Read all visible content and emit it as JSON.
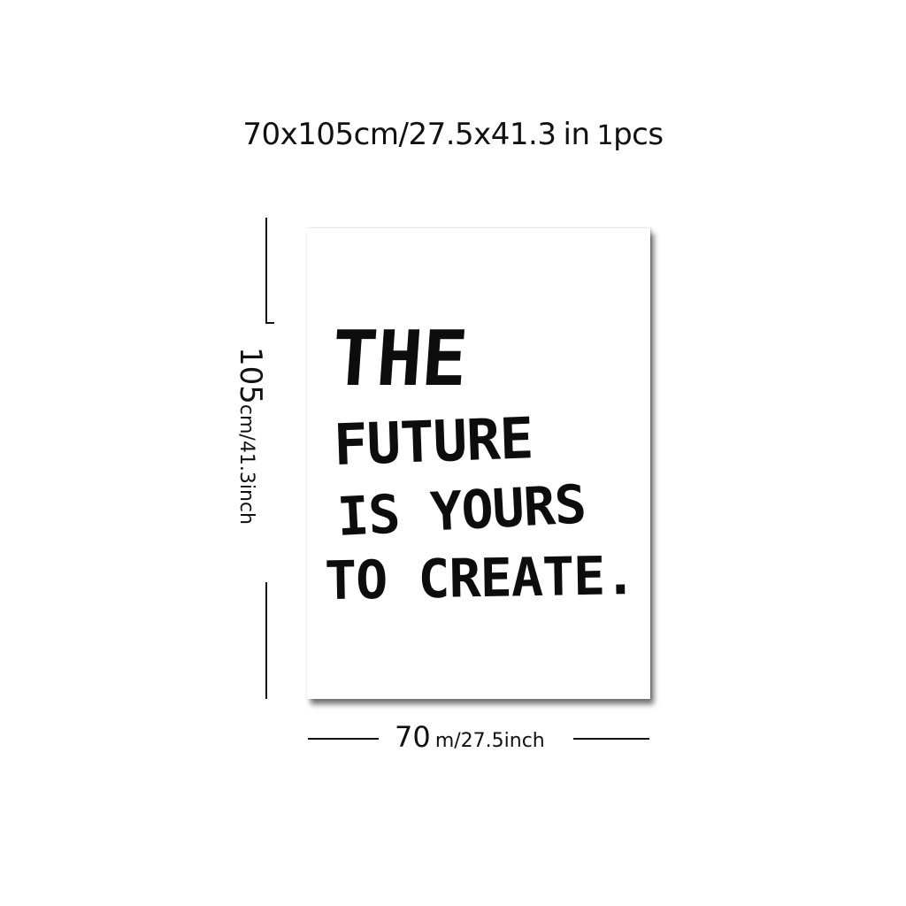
{
  "headline": {
    "part1": "70x105cm/",
    "part2": "27.5x41.3",
    "part3": "in",
    "part4": "1",
    "part5": "pcs"
  },
  "height_label": {
    "number": "105",
    "unit": "cm/41.3inch"
  },
  "width_label": {
    "number": "70",
    "unit": "m/27.5inch"
  },
  "poster": {
    "line1": "THE",
    "line2": "FUTURE",
    "line3": "IS YOURS",
    "line4": "TO CREATE."
  },
  "colors": {
    "ink": "#111111",
    "background": "#ffffff"
  }
}
